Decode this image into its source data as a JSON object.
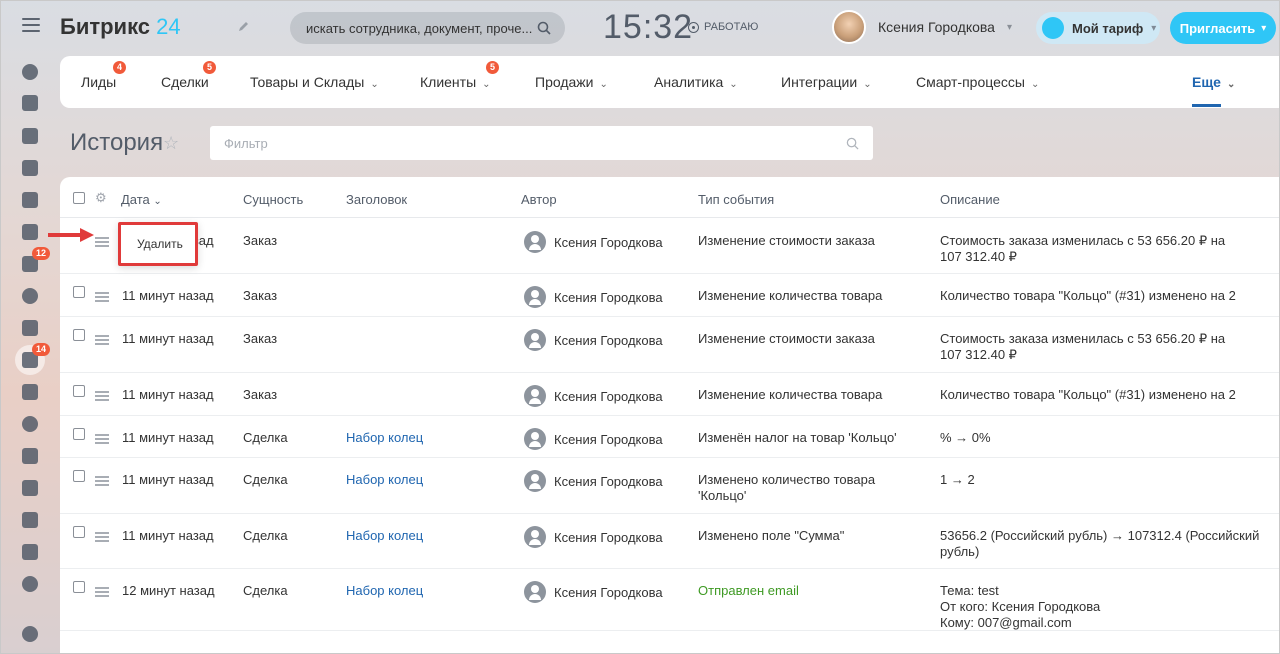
{
  "app": {
    "logo_name": "Битрикс",
    "logo_num": "24"
  },
  "header": {
    "search_placeholder": "искать сотрудника, документ, проче...",
    "clock": "15:32",
    "work_status": "РАБОТАЮ",
    "user_name": "Ксения Городкова",
    "tariff_label": "Мой тариф",
    "invite_label": "Пригласить"
  },
  "sidebar": {
    "badges": {
      "mail": "12",
      "crm": "14"
    }
  },
  "menu": {
    "items": [
      {
        "label": "Лиды",
        "badge": "4"
      },
      {
        "label": "Сделки",
        "badge": "5"
      },
      {
        "label": "Товары и Склады"
      },
      {
        "label": "Клиенты",
        "badge": "5"
      },
      {
        "label": "Продажи"
      },
      {
        "label": "Аналитика"
      },
      {
        "label": "Интеграции"
      },
      {
        "label": "Смарт-процессы"
      },
      {
        "label": "Еще"
      }
    ]
  },
  "page": {
    "title": "История",
    "filter_placeholder": "Фильтр"
  },
  "grid": {
    "columns": [
      "Дата",
      "Сущность",
      "Заголовок",
      "Автор",
      "Тип события",
      "Описание"
    ],
    "rows": [
      {
        "date": "11 минут назад",
        "entity": "Заказ",
        "title": "",
        "author": "Ксения Городкова",
        "event": "Изменение стоимости заказа",
        "desc1": "Стоимость заказа изменилась с 53 656.20 ₽ на",
        "desc2": "107 312.40 ₽",
        "desc3": ""
      },
      {
        "date": "11 минут назад",
        "entity": "Заказ",
        "title": "",
        "author": "Ксения Городкова",
        "event": "Изменение количества товара",
        "desc1": "Количество товара \"Кольцо\" (#31) изменено на 2",
        "desc2": "",
        "desc3": ""
      },
      {
        "date": "11 минут назад",
        "entity": "Заказ",
        "title": "",
        "author": "Ксения Городкова",
        "event": "Изменение стоимости заказа",
        "desc1": "Стоимость заказа изменилась с 53 656.20 ₽ на",
        "desc2": "107 312.40 ₽",
        "desc3": ""
      },
      {
        "date": "11 минут назад",
        "entity": "Заказ",
        "title": "",
        "author": "Ксения Городкова",
        "event": "Изменение количества товара",
        "desc1": "Количество товара \"Кольцо\" (#31) изменено на 2",
        "desc2": "",
        "desc3": ""
      },
      {
        "date": "11 минут назад",
        "entity": "Сделка",
        "title": "Набор колец",
        "author": "Ксения Городкова",
        "event": "Изменён налог на товар 'Кольцо'",
        "desc1": "% → 0%",
        "desc2": "",
        "desc3": ""
      },
      {
        "date": "11 минут назад",
        "entity": "Сделка",
        "title": "Набор колец",
        "author": "Ксения Городкова",
        "event": "Изменено количество товара",
        "event2": "'Кольцо'",
        "desc1": "1 → 2",
        "desc2": "",
        "desc3": ""
      },
      {
        "date": "11 минут назад",
        "entity": "Сделка",
        "title": "Набор колец",
        "author": "Ксения Городкова",
        "event": "Изменено поле \"Сумма\"",
        "desc1": "53656.2 (Российский рубль) → 107312.4 (Российский",
        "desc2": "рубль)",
        "desc3": ""
      },
      {
        "date": "12 минут назад",
        "entity": "Сделка",
        "title": "Набор колец",
        "author": "Ксения Городкова",
        "event": "Отправлен email",
        "desc1": "Тема: test",
        "desc2": "От кого: Ксения Городкова",
        "desc3": "Кому: 007@gmail.com"
      }
    ]
  },
  "context_menu": {
    "delete_label": "Удалить"
  },
  "colors": {
    "accent": "#2fc6f6",
    "link": "#2066b0",
    "badge": "#f15a3a",
    "annotation": "#e03a3a",
    "green": "#3f9a24"
  }
}
